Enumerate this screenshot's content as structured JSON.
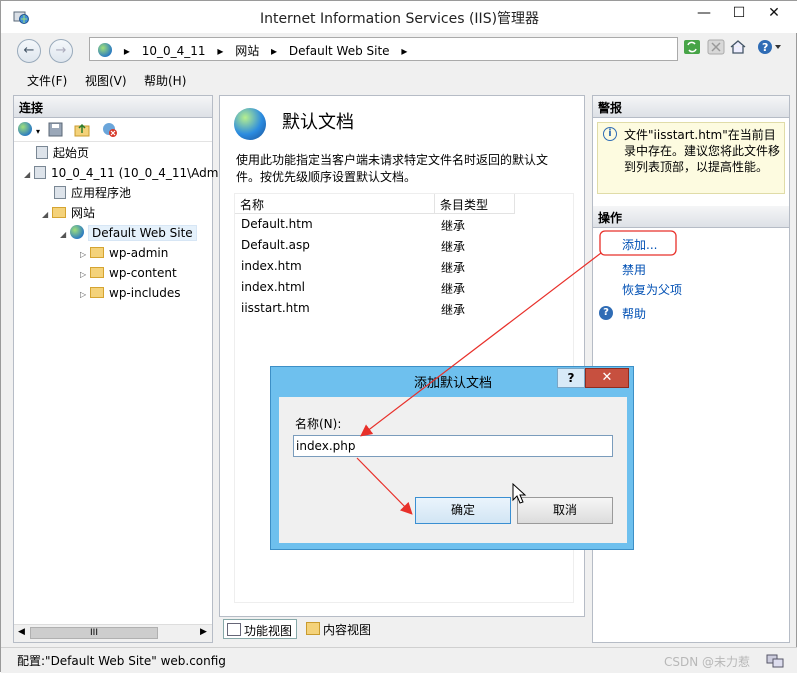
{
  "window": {
    "title": "Internet Information Services (IIS)管理器",
    "controls": {
      "minimize": "—",
      "maximize": "☐",
      "close": "✕"
    }
  },
  "address": {
    "crumbs": [
      "▸",
      "10_0_4_11",
      "▸",
      "网站",
      "▸",
      "Default Web Site",
      "▸"
    ]
  },
  "menu": {
    "file": "文件(F)",
    "view": "视图(V)",
    "help": "帮助(H)"
  },
  "connections": {
    "header": "连接",
    "tree": {
      "start_page": "起始页",
      "server": "10_0_4_11 (10_0_4_11\\Adm",
      "app_pools": "应用程序池",
      "sites": "网站",
      "default_site": "Default Web Site",
      "folders": [
        "wp-admin",
        "wp-content",
        "wp-includes"
      ]
    },
    "hscroll_label": "III"
  },
  "main": {
    "title": "默认文档",
    "description": "使用此功能指定当客户端未请求特定文件名时返回的默认文件。按优先级顺序设置默认文档。",
    "columns": {
      "name": "名称",
      "type": "条目类型"
    },
    "rows": [
      {
        "name": "Default.htm",
        "type": "继承"
      },
      {
        "name": "Default.asp",
        "type": "继承"
      },
      {
        "name": "index.htm",
        "type": "继承"
      },
      {
        "name": "index.html",
        "type": "继承"
      },
      {
        "name": "iisstart.htm",
        "type": "继承"
      }
    ],
    "view_tabs": {
      "features": "功能视图",
      "content": "内容视图"
    }
  },
  "right": {
    "alerts_header": "警报",
    "alert_text": "文件\"iisstart.htm\"在当前目录中存在。建议您将此文件移到列表顶部，以提高性能。",
    "actions_header": "操作",
    "actions": {
      "add": "添加...",
      "disable": "禁用",
      "revert": "恢复为父项",
      "help": "帮助"
    }
  },
  "status": {
    "text": "配置:\"Default Web Site\" web.config"
  },
  "watermark": "CSDN @未力惹",
  "dialog": {
    "title": "添加默认文档",
    "help_btn": "?",
    "close_btn": "✕",
    "name_label": "名称(N):",
    "name_value": "index.php",
    "ok": "确定",
    "cancel": "取消"
  },
  "annotation_color": "#e8302a"
}
